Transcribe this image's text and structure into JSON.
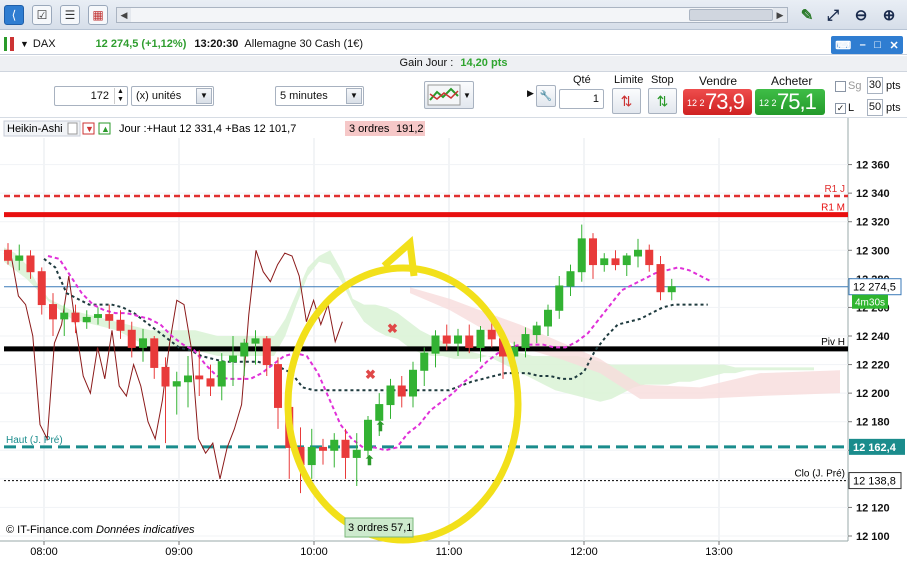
{
  "toolbar": {
    "icons": [
      "share-icon",
      "checklist-icon",
      "list-icon",
      "grid-add-icon"
    ],
    "nav_left": "◀",
    "nav_right": "▶",
    "zoom_icons": [
      "crosshair-icon",
      "zoom-fit-icon",
      "zoom-out-icon",
      "zoom-in-icon"
    ]
  },
  "window": {
    "instrument": "DAX",
    "price_change": "12 274,5 (+1,12%)",
    "time": "13:20:30",
    "name": "Allemagne 30 Cash (1€)"
  },
  "gain": {
    "label": "Gain Jour :",
    "value": "14,20 pts",
    "value_color": "#2fa52f"
  },
  "controls": {
    "quantity": "172",
    "units": "(x) unités",
    "timeframe": "5 minutes",
    "qty_label": "Qté",
    "qty_value": "1",
    "limit_label": "Limite",
    "stop_label": "Stop",
    "sell_label": "Vendre",
    "buy_label": "Acheter",
    "sell_small": "12 2",
    "sell_big": "73,9",
    "buy_small": "12 2",
    "buy_big": "75,1",
    "sg_label": "Sg",
    "sg_value": "30",
    "l_label": "L",
    "l_value": "50",
    "pts1": "pts",
    "pts2": "pts"
  },
  "chart_header": {
    "type": "Heikin-Ashi",
    "info": "Jour :+Haut 12 331,4 +Bas 12 101,7",
    "orders": "3 ordres",
    "orders_value": "191,2"
  },
  "chart_data": {
    "type": "candlestick",
    "ylim": [
      12090,
      12370
    ],
    "y_ticks": [
      "12 360",
      "12 340",
      "12 320",
      "12 300",
      "12 280",
      "12 260",
      "12 240",
      "12 220",
      "12 200",
      "12 180",
      "12 160",
      "12 140",
      "12 120",
      "12 100"
    ],
    "y_tick_values": [
      12360,
      12340,
      12320,
      12300,
      12280,
      12260,
      12240,
      12220,
      12200,
      12180,
      12160,
      12140,
      12120,
      12100
    ],
    "x_ticks": [
      "08:00",
      "09:00",
      "10:00",
      "11:00",
      "12:00",
      "13:00"
    ],
    "x_tick_values": [
      0,
      12,
      24,
      36,
      48,
      60
    ],
    "levels": [
      {
        "name": "R1 J",
        "value": 12338,
        "color": "#e03030",
        "style": "dashed"
      },
      {
        "name": "R1 M",
        "value": 12325,
        "color": "#e81010",
        "style": "solid"
      },
      {
        "name": "Piv H",
        "value": 12231,
        "color": "#000000",
        "style": "solid"
      },
      {
        "name": "Haut (J. Pré)",
        "value": 12162.4,
        "color": "#1a8c8c",
        "style": "dashed"
      },
      {
        "name": "Clo (J. Pré)",
        "value": 12138.8,
        "color": "#000000",
        "style": "dotted"
      }
    ],
    "current_price": "12 274,5",
    "current_price_value": 12274.5,
    "haut_tag": "12 162,4",
    "clo_tag": "12 138,8",
    "countdown": "4m30s",
    "candles": [
      [
        12300,
        12305,
        12290,
        12293
      ],
      [
        12293,
        12304,
        12286,
        12296
      ],
      [
        12296,
        12300,
        12280,
        12285
      ],
      [
        12285,
        12288,
        12255,
        12262
      ],
      [
        12262,
        12270,
        12240,
        12252
      ],
      [
        12252,
        12262,
        12240,
        12256
      ],
      [
        12256,
        12262,
        12242,
        12250
      ],
      [
        12250,
        12258,
        12245,
        12253
      ],
      [
        12253,
        12260,
        12248,
        12255
      ],
      [
        12255,
        12262,
        12245,
        12251
      ],
      [
        12251,
        12258,
        12238,
        12244
      ],
      [
        12244,
        12250,
        12225,
        12232
      ],
      [
        12232,
        12245,
        12222,
        12238
      ],
      [
        12238,
        12240,
        12210,
        12218
      ],
      [
        12218,
        12225,
        12165,
        12205
      ],
      [
        12205,
        12215,
        12185,
        12208
      ],
      [
        12208,
        12226,
        12190,
        12212
      ],
      [
        12212,
        12230,
        12198,
        12210
      ],
      [
        12210,
        12220,
        12198,
        12205
      ],
      [
        12205,
        12228,
        12195,
        12222
      ],
      [
        12222,
        12240,
        12205,
        12226
      ],
      [
        12226,
        12238,
        12212,
        12235
      ],
      [
        12235,
        12244,
        12220,
        12238
      ],
      [
        12238,
        12240,
        12212,
        12220
      ],
      [
        12220,
        12225,
        12175,
        12190
      ],
      [
        12190,
        12200,
        12140,
        12162
      ],
      [
        12162,
        12176,
        12130,
        12150
      ],
      [
        12150,
        12175,
        12140,
        12162
      ],
      [
        12162,
        12168,
        12150,
        12160
      ],
      [
        12160,
        12172,
        12148,
        12167
      ],
      [
        12167,
        12175,
        12140,
        12155
      ],
      [
        12155,
        12172,
        12135,
        12160
      ],
      [
        12160,
        12184,
        12155,
        12181
      ],
      [
        12181,
        12200,
        12170,
        12192
      ],
      [
        12192,
        12210,
        12182,
        12205
      ],
      [
        12205,
        12212,
        12190,
        12198
      ],
      [
        12198,
        12222,
        12190,
        12216
      ],
      [
        12216,
        12232,
        12205,
        12228
      ],
      [
        12228,
        12244,
        12218,
        12240
      ],
      [
        12240,
        12248,
        12230,
        12235
      ],
      [
        12235,
        12245,
        12226,
        12240
      ],
      [
        12240,
        12248,
        12228,
        12232
      ],
      [
        12232,
        12247,
        12222,
        12244
      ],
      [
        12244,
        12252,
        12232,
        12238
      ],
      [
        12238,
        12244,
        12210,
        12226
      ],
      [
        12226,
        12236,
        12210,
        12232
      ],
      [
        12232,
        12246,
        12225,
        12241
      ],
      [
        12241,
        12250,
        12235,
        12247
      ],
      [
        12247,
        12262,
        12240,
        12258
      ],
      [
        12258,
        12282,
        12252,
        12275
      ],
      [
        12275,
        12290,
        12268,
        12285
      ],
      [
        12285,
        12318,
        12278,
        12308
      ],
      [
        12308,
        12312,
        12280,
        12290
      ],
      [
        12290,
        12298,
        12285,
        12294
      ],
      [
        12294,
        12300,
        12286,
        12290
      ],
      [
        12290,
        12298,
        12282,
        12296
      ],
      [
        12296,
        12308,
        12288,
        12300
      ],
      [
        12300,
        12304,
        12285,
        12290
      ],
      [
        12290,
        12296,
        12265,
        12271
      ],
      [
        12271,
        12280,
        12265,
        12274.5
      ]
    ],
    "overlay_label": "3 ordres",
    "overlay_value": "57,1",
    "footer": "© IT-Finance.com",
    "footer_note": "Données indicatives"
  }
}
